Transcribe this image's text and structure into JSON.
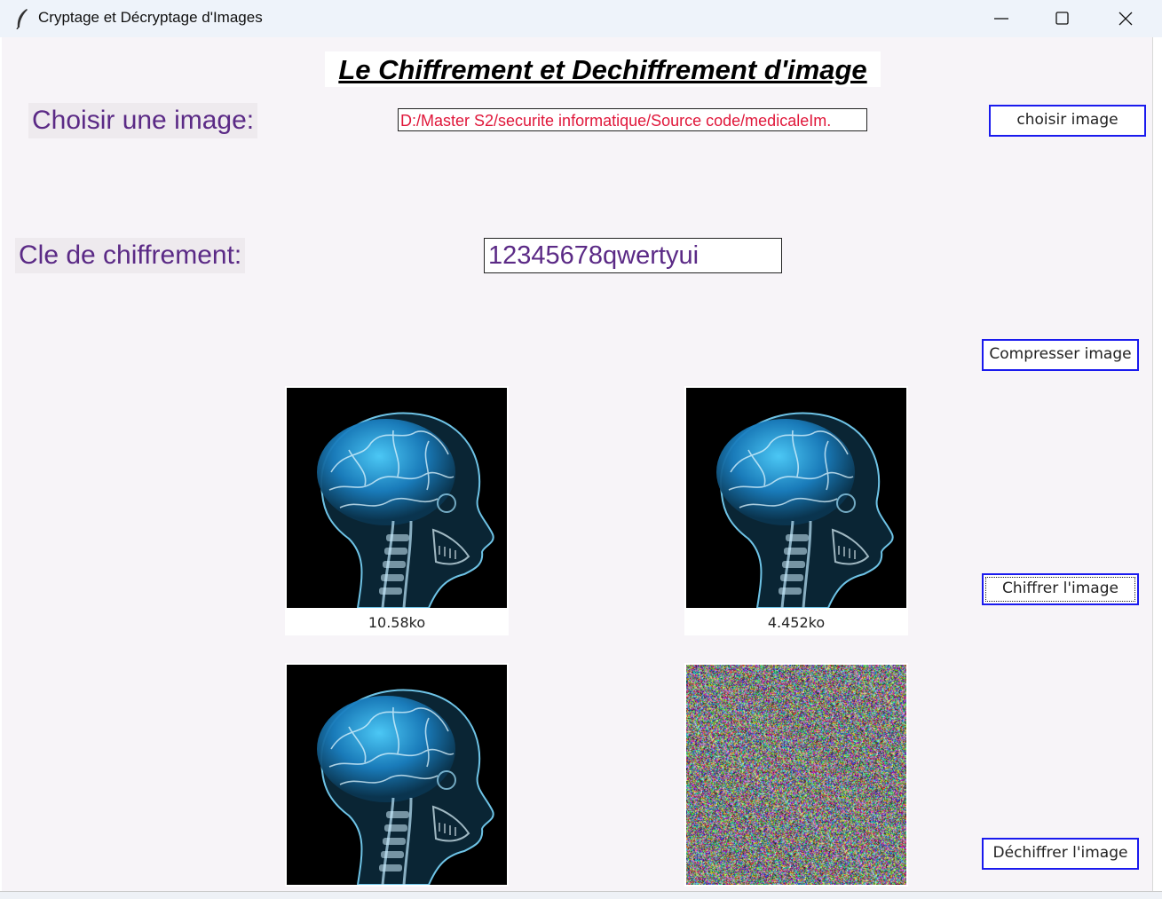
{
  "window": {
    "title": "Cryptage et Décryptage d'Images",
    "icon": "feather-icon",
    "controls": [
      "minimize-icon",
      "maximize-icon",
      "close-icon"
    ]
  },
  "main": {
    "heading": "Le Chiffrement et Dechiffrement d'image",
    "choose_label": "Choisir une image:",
    "image_path": "D:/Master S2/securite informatique/Source code/medicaleIm.",
    "key_label": "Cle de chiffrement:",
    "key_value": "12345678qwertyui"
  },
  "buttons": {
    "choose": "choisir image",
    "compress": "Compresser image",
    "encrypt": "Chiffrer l'image",
    "decrypt": "Déchiffrer l'image"
  },
  "images": {
    "original_size": "10.58ko",
    "compressed_size": "4.452ko",
    "original_alt": "brain x-ray image",
    "encrypted_alt": "encrypted noise image"
  },
  "colors": {
    "label_text": "#5b2a86",
    "path_text": "#e0173a",
    "button_border": "#1a1aee",
    "background": "#f7f4f8"
  }
}
